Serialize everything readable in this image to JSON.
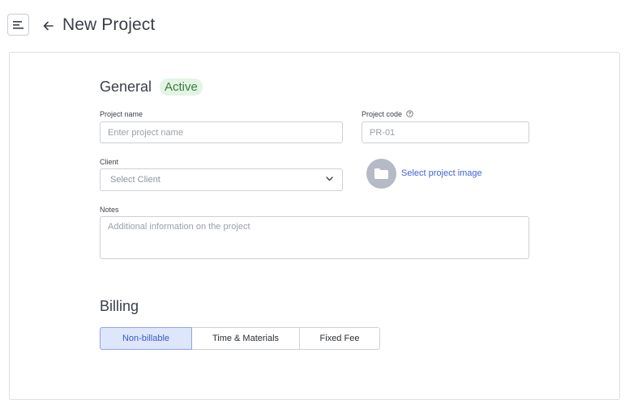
{
  "header": {
    "title": "New Project",
    "menu_icon": "menu-lines-icon",
    "back_icon": "arrow-left-icon"
  },
  "general": {
    "title": "General",
    "status_badge": "Active",
    "project_name": {
      "label": "Project name",
      "placeholder": "Enter project name",
      "value": ""
    },
    "project_code": {
      "label": "Project code",
      "placeholder": "PR-01",
      "value": "",
      "help_icon": "question-circle-icon"
    },
    "client": {
      "label": "Client",
      "selected": "Select Client",
      "icon": "chevron-down-icon"
    },
    "project_image": {
      "link": "Select project image",
      "icon": "folder-icon"
    },
    "notes": {
      "label": "Notes",
      "placeholder": "Additional information on the project",
      "value": ""
    }
  },
  "billing": {
    "title": "Billing",
    "options": [
      {
        "label": "Non-billable",
        "active": true
      },
      {
        "label": "Time & Materials",
        "active": false
      },
      {
        "label": "Fixed Fee",
        "active": false
      }
    ]
  },
  "colors": {
    "accent": "#3d63d6",
    "badge_bg": "#e4f4e4",
    "badge_text": "#3b7d3b",
    "active_segment_bg": "#dde6fb"
  }
}
